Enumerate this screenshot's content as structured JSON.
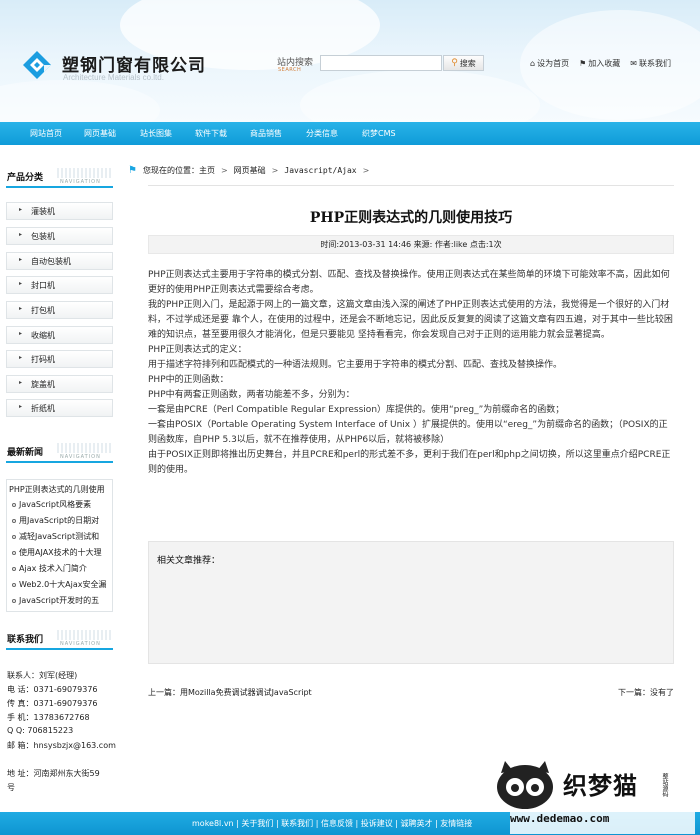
{
  "header": {
    "company_name": "塑钢门窗有限公司",
    "company_en": "Architecture Materials co.ltd.",
    "search_label": "站内搜索",
    "search_sub": "SEARCH",
    "search_placeholder": "",
    "search_button": "搜索",
    "links": [
      "设为首页",
      "加入收藏",
      "联系我们"
    ]
  },
  "nav": [
    "网站首页",
    "网页基础",
    "站长图集",
    "软件下载",
    "商品销售",
    "分类信息",
    "织梦CMS"
  ],
  "sidebar": {
    "categories_title": "产品分类",
    "navigation": "NAVIGATION",
    "categories": [
      "灌装机",
      "包装机",
      "自动包装机",
      "封口机",
      "打包机",
      "收缩机",
      "打码机",
      "旋盖机",
      "折纸机"
    ],
    "news_title": "最新新闻",
    "news_current": "PHP正则表达式的几则使用",
    "news": [
      "JavaScript风格要素",
      "用JavaScript的日期对",
      "减轻JavaScript测试和",
      "使用AJAX技术的十大理",
      "Ajax 技术入门简介",
      "Web2.0十大Ajax安全漏",
      "JavaScript开发时的五"
    ],
    "contact_title": "联系我们",
    "contact": [
      "联系人：刘军(经理)",
      "电 话：0371-69079376",
      "传 真：0371-69079376",
      "手 机：13783672768",
      "Q Q:  706815223",
      "邮 箱：hnsysbzjx@163.com"
    ],
    "address_line1": "地 址：河南郑州东大街59",
    "address_line2": "号"
  },
  "breadcrumb": {
    "prefix": "您现在的位置：",
    "items": [
      "主页",
      "网页基础",
      "Javascript/Ajax"
    ]
  },
  "article": {
    "title": "PHP正则表达式的几则使用技巧",
    "meta": "时间:2013-03-31 14:46 来源: 作者:like 点击:1次",
    "paragraphs": [
      "PHP正则表达式主要用于字符串的模式分割、匹配、查找及替换操作。使用正则表达式在某些简单的环境下可能效率不高，因此如何更好的使用PHP正则表达式需要综合考虑。",
      "我的PHP正则入门，是起源于网上的一篇文章，这篇文章由浅入深的阐述了PHP正则表达式使用的方法，我觉得是一个很好的入门材料，不过学成还是要 靠个人，在使用的过程中，还是会不断地忘记，因此反反复复的阅读了这篇文章有四五遍，对于其中一些比较困难的知识点，甚至要用很久才能消化，但是只要能见 坚持看看完，你会发现自己对于正则的运用能力就会显著提高。",
      "PHP正则表达式的定义：",
      "用于描述字符排列和匹配模式的一种语法规则。它主要用于字符串的模式分割、匹配、查找及替换操作。",
      "PHP中的正则函数：",
      "PHP中有两套正则函数，两者功能差不多，分别为：",
      "一套是由PCRE（Perl Compatible Regular Expression）库提供的。使用“preg_”为前缀命名的函数；",
      "一套由POSIX（Portable Operating System Interface of Unix ）扩展提供的。使用以“ereg_”为前缀命名的函数；（POSIX的正则函数库，自PHP 5.3以后，就不在推荐使用，从PHP6以后，就将被移除）",
      "由于POSIX正则即将推出历史舞台，并且PCRE和perl的形式差不多，更利于我们在perl和php之间切换，所以这里重点介绍PCRE正则的使用。"
    ],
    "related_title": "相关文章推荐：",
    "prev": "上一篇：用Mozilla免费调试器调试JavaScript",
    "next": "下一篇：没有了"
  },
  "footer": {
    "links": "moke8l.vn | 关于我们 | 联系我们 | 信息反馈 | 投诉建议 | 诚聘英才 | 友情链接"
  },
  "watermark": {
    "cn": "织梦猫",
    "site": "www.dedemao.com",
    "tag": "整站源码"
  },
  "colors": {
    "accent": "#17a6e0",
    "nav": "#1aa6e2"
  }
}
